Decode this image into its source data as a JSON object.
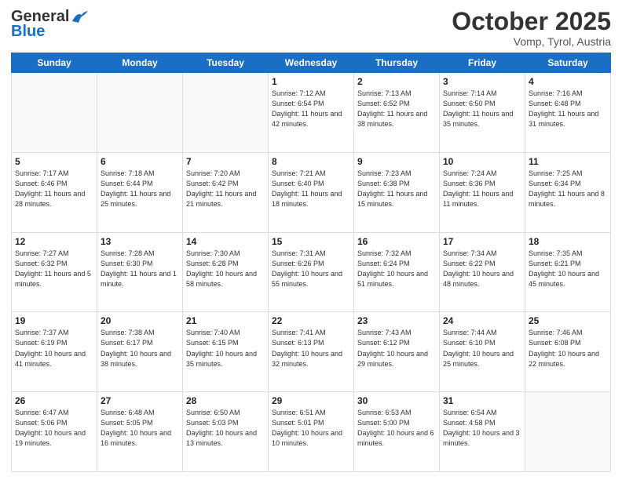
{
  "header": {
    "logo_line1": "General",
    "logo_line2": "Blue",
    "month_year": "October 2025",
    "location": "Vomp, Tyrol, Austria"
  },
  "weekdays": [
    "Sunday",
    "Monday",
    "Tuesday",
    "Wednesday",
    "Thursday",
    "Friday",
    "Saturday"
  ],
  "weeks": [
    [
      {
        "day": "",
        "sunrise": "",
        "sunset": "",
        "daylight": ""
      },
      {
        "day": "",
        "sunrise": "",
        "sunset": "",
        "daylight": ""
      },
      {
        "day": "",
        "sunrise": "",
        "sunset": "",
        "daylight": ""
      },
      {
        "day": "1",
        "sunrise": "Sunrise: 7:12 AM",
        "sunset": "Sunset: 6:54 PM",
        "daylight": "Daylight: 11 hours and 42 minutes."
      },
      {
        "day": "2",
        "sunrise": "Sunrise: 7:13 AM",
        "sunset": "Sunset: 6:52 PM",
        "daylight": "Daylight: 11 hours and 38 minutes."
      },
      {
        "day": "3",
        "sunrise": "Sunrise: 7:14 AM",
        "sunset": "Sunset: 6:50 PM",
        "daylight": "Daylight: 11 hours and 35 minutes."
      },
      {
        "day": "4",
        "sunrise": "Sunrise: 7:16 AM",
        "sunset": "Sunset: 6:48 PM",
        "daylight": "Daylight: 11 hours and 31 minutes."
      }
    ],
    [
      {
        "day": "5",
        "sunrise": "Sunrise: 7:17 AM",
        "sunset": "Sunset: 6:46 PM",
        "daylight": "Daylight: 11 hours and 28 minutes."
      },
      {
        "day": "6",
        "sunrise": "Sunrise: 7:18 AM",
        "sunset": "Sunset: 6:44 PM",
        "daylight": "Daylight: 11 hours and 25 minutes."
      },
      {
        "day": "7",
        "sunrise": "Sunrise: 7:20 AM",
        "sunset": "Sunset: 6:42 PM",
        "daylight": "Daylight: 11 hours and 21 minutes."
      },
      {
        "day": "8",
        "sunrise": "Sunrise: 7:21 AM",
        "sunset": "Sunset: 6:40 PM",
        "daylight": "Daylight: 11 hours and 18 minutes."
      },
      {
        "day": "9",
        "sunrise": "Sunrise: 7:23 AM",
        "sunset": "Sunset: 6:38 PM",
        "daylight": "Daylight: 11 hours and 15 minutes."
      },
      {
        "day": "10",
        "sunrise": "Sunrise: 7:24 AM",
        "sunset": "Sunset: 6:36 PM",
        "daylight": "Daylight: 11 hours and 11 minutes."
      },
      {
        "day": "11",
        "sunrise": "Sunrise: 7:25 AM",
        "sunset": "Sunset: 6:34 PM",
        "daylight": "Daylight: 11 hours and 8 minutes."
      }
    ],
    [
      {
        "day": "12",
        "sunrise": "Sunrise: 7:27 AM",
        "sunset": "Sunset: 6:32 PM",
        "daylight": "Daylight: 11 hours and 5 minutes."
      },
      {
        "day": "13",
        "sunrise": "Sunrise: 7:28 AM",
        "sunset": "Sunset: 6:30 PM",
        "daylight": "Daylight: 11 hours and 1 minute."
      },
      {
        "day": "14",
        "sunrise": "Sunrise: 7:30 AM",
        "sunset": "Sunset: 6:28 PM",
        "daylight": "Daylight: 10 hours and 58 minutes."
      },
      {
        "day": "15",
        "sunrise": "Sunrise: 7:31 AM",
        "sunset": "Sunset: 6:26 PM",
        "daylight": "Daylight: 10 hours and 55 minutes."
      },
      {
        "day": "16",
        "sunrise": "Sunrise: 7:32 AM",
        "sunset": "Sunset: 6:24 PM",
        "daylight": "Daylight: 10 hours and 51 minutes."
      },
      {
        "day": "17",
        "sunrise": "Sunrise: 7:34 AM",
        "sunset": "Sunset: 6:22 PM",
        "daylight": "Daylight: 10 hours and 48 minutes."
      },
      {
        "day": "18",
        "sunrise": "Sunrise: 7:35 AM",
        "sunset": "Sunset: 6:21 PM",
        "daylight": "Daylight: 10 hours and 45 minutes."
      }
    ],
    [
      {
        "day": "19",
        "sunrise": "Sunrise: 7:37 AM",
        "sunset": "Sunset: 6:19 PM",
        "daylight": "Daylight: 10 hours and 41 minutes."
      },
      {
        "day": "20",
        "sunrise": "Sunrise: 7:38 AM",
        "sunset": "Sunset: 6:17 PM",
        "daylight": "Daylight: 10 hours and 38 minutes."
      },
      {
        "day": "21",
        "sunrise": "Sunrise: 7:40 AM",
        "sunset": "Sunset: 6:15 PM",
        "daylight": "Daylight: 10 hours and 35 minutes."
      },
      {
        "day": "22",
        "sunrise": "Sunrise: 7:41 AM",
        "sunset": "Sunset: 6:13 PM",
        "daylight": "Daylight: 10 hours and 32 minutes."
      },
      {
        "day": "23",
        "sunrise": "Sunrise: 7:43 AM",
        "sunset": "Sunset: 6:12 PM",
        "daylight": "Daylight: 10 hours and 29 minutes."
      },
      {
        "day": "24",
        "sunrise": "Sunrise: 7:44 AM",
        "sunset": "Sunset: 6:10 PM",
        "daylight": "Daylight: 10 hours and 25 minutes."
      },
      {
        "day": "25",
        "sunrise": "Sunrise: 7:46 AM",
        "sunset": "Sunset: 6:08 PM",
        "daylight": "Daylight: 10 hours and 22 minutes."
      }
    ],
    [
      {
        "day": "26",
        "sunrise": "Sunrise: 6:47 AM",
        "sunset": "Sunset: 5:06 PM",
        "daylight": "Daylight: 10 hours and 19 minutes."
      },
      {
        "day": "27",
        "sunrise": "Sunrise: 6:48 AM",
        "sunset": "Sunset: 5:05 PM",
        "daylight": "Daylight: 10 hours and 16 minutes."
      },
      {
        "day": "28",
        "sunrise": "Sunrise: 6:50 AM",
        "sunset": "Sunset: 5:03 PM",
        "daylight": "Daylight: 10 hours and 13 minutes."
      },
      {
        "day": "29",
        "sunrise": "Sunrise: 6:51 AM",
        "sunset": "Sunset: 5:01 PM",
        "daylight": "Daylight: 10 hours and 10 minutes."
      },
      {
        "day": "30",
        "sunrise": "Sunrise: 6:53 AM",
        "sunset": "Sunset: 5:00 PM",
        "daylight": "Daylight: 10 hours and 6 minutes."
      },
      {
        "day": "31",
        "sunrise": "Sunrise: 6:54 AM",
        "sunset": "Sunset: 4:58 PM",
        "daylight": "Daylight: 10 hours and 3 minutes."
      },
      {
        "day": "",
        "sunrise": "",
        "sunset": "",
        "daylight": ""
      }
    ]
  ]
}
